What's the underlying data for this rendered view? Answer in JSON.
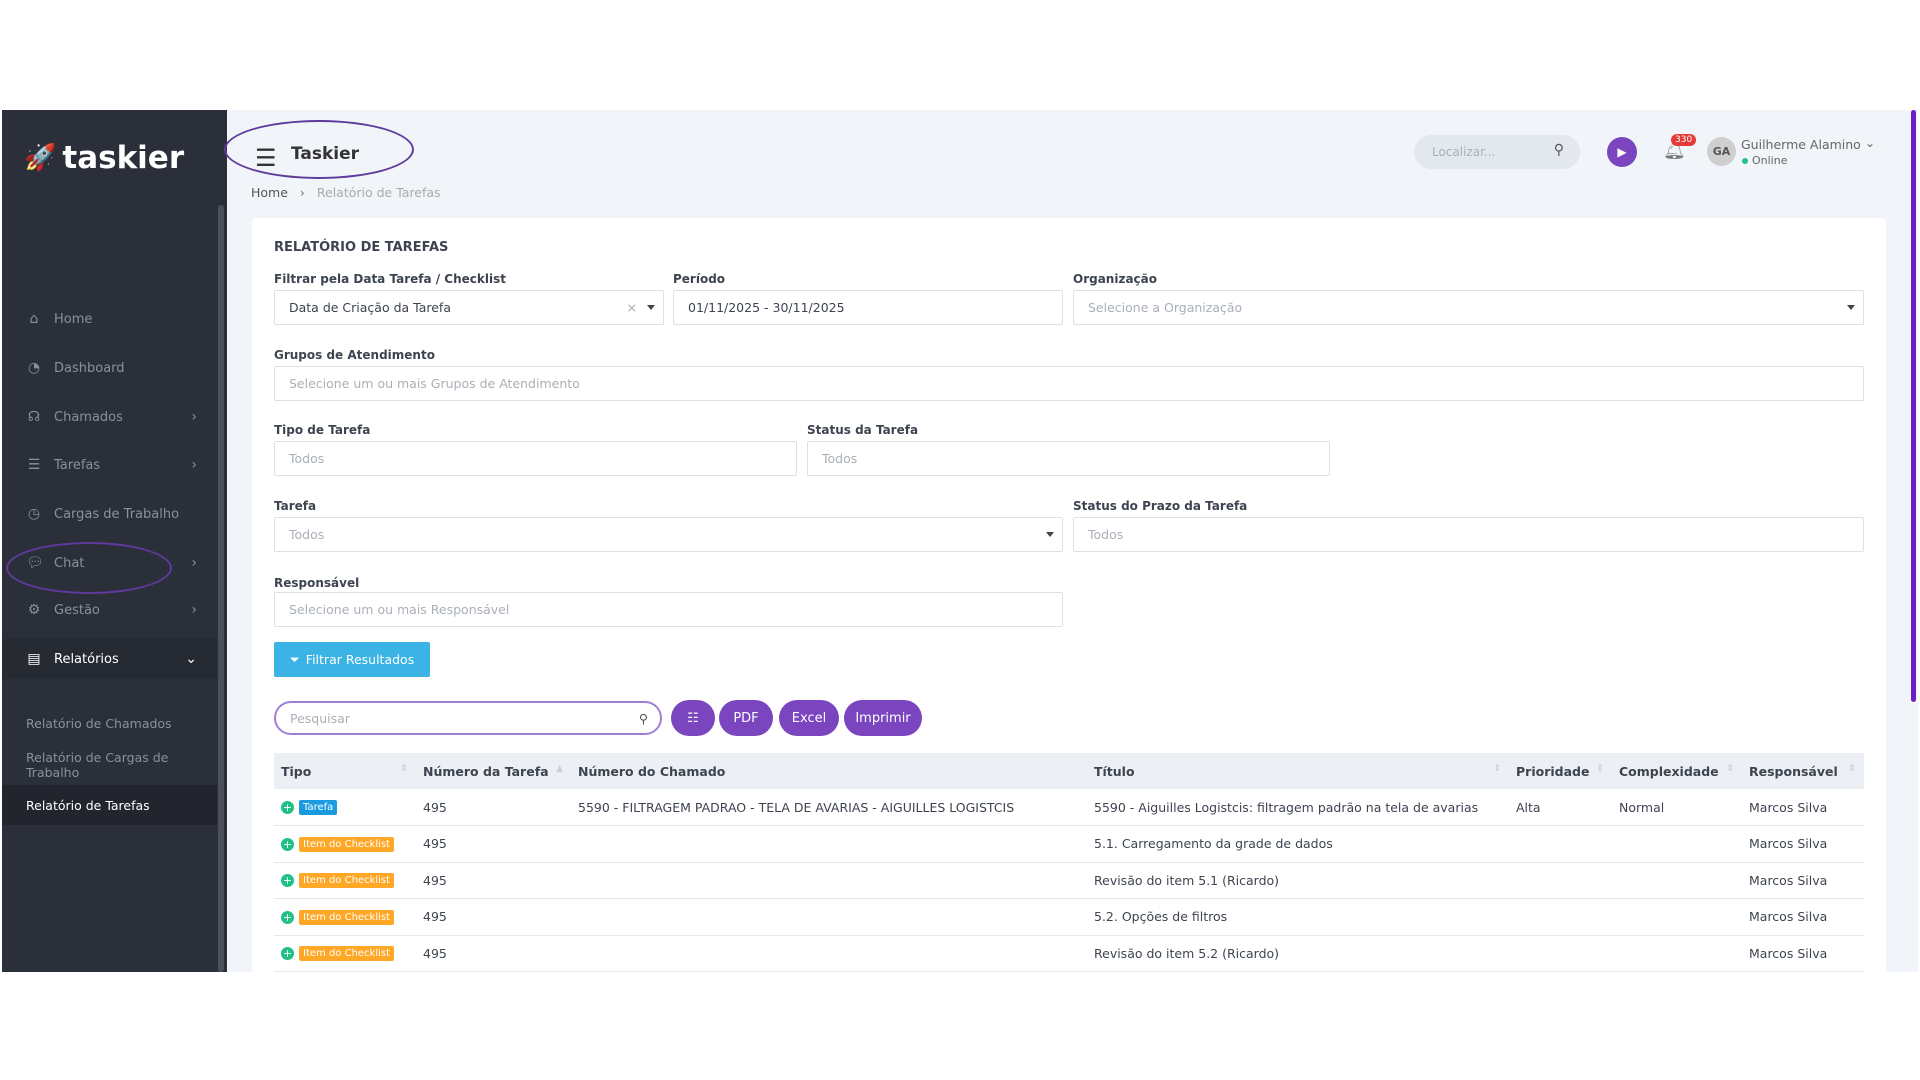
{
  "brand": {
    "name": "taskier"
  },
  "sidebar": {
    "items": [
      {
        "label": "Home",
        "icon": "home-icon"
      },
      {
        "label": "Dashboard",
        "icon": "pie-chart-icon"
      },
      {
        "label": "Chamados",
        "icon": "headset-icon"
      },
      {
        "label": "Tarefas",
        "icon": "list-icon"
      },
      {
        "label": "Cargas de Trabalho",
        "icon": "clock-icon"
      },
      {
        "label": "Chat",
        "icon": "chat-icon"
      },
      {
        "label": "Gestão",
        "icon": "gear-icon"
      },
      {
        "label": "Relatórios",
        "icon": "file-icon"
      }
    ],
    "subitems": [
      "Relatório de Chamados",
      "Relatório de Cargas de Trabalho",
      "Relatório de Tarefas"
    ]
  },
  "header": {
    "title": "Taskier",
    "search_placeholder": "Localizar...",
    "notif_count": "330",
    "user_initials": "GA",
    "user_name": "Guilherme Alamino",
    "user_status": "Online"
  },
  "breadcrumb": {
    "home": "Home",
    "current": "Relatório de Tarefas"
  },
  "form": {
    "title": "RELATÓRIO DE TAREFAS",
    "filtro_label": "Filtrar pela Data Tarefa / Checklist",
    "filtro_value": "Data de Criação da Tarefa",
    "periodo_label": "Período",
    "periodo_value": "01/11/2025 - 30/11/2025",
    "org_label": "Organização",
    "org_placeholder": "Selecione a Organização",
    "grupos_label": "Grupos de Atendimento",
    "grupos_placeholder": "Selecione um ou mais Grupos de Atendimento",
    "tipo_label": "Tipo de Tarefa",
    "tipo_placeholder": "Todos",
    "status_label": "Status da Tarefa",
    "status_placeholder": "Todos",
    "tarefa_label": "Tarefa",
    "tarefa_placeholder": "Todos",
    "prazo_label": "Status do Prazo da Tarefa",
    "prazo_placeholder": "Todos",
    "resp_label": "Responsável",
    "resp_placeholder": "Selecione um ou mais Responsável",
    "filter_button": "Filtrar Resultados"
  },
  "toolbar": {
    "search_placeholder": "Pesquisar",
    "pdf": "PDF",
    "excel": "Excel",
    "print": "Imprimir"
  },
  "table": {
    "columns": [
      "Tipo",
      "Número da Tarefa",
      "Número do Chamado",
      "Título",
      "Prioridade",
      "Complexidade",
      "Responsável"
    ],
    "rows": [
      {
        "tipo": "Tarefa",
        "tipo_color": "#1a9be0",
        "numero": "495",
        "chamado": "5590 - FILTRAGEM PADRAO - TELA DE AVARIAS - AIGUILLES LOGISTCIS",
        "titulo": "5590 - Aiguilles Logistcis: filtragem padrão na tela de avarias",
        "prioridade": "Alta",
        "complexidade": "Normal",
        "responsavel": "Marcos Silva"
      },
      {
        "tipo": "Item do Checklist",
        "tipo_color": "#ffa726",
        "numero": "495",
        "chamado": "",
        "titulo": "5.1. Carregamento da grade de dados",
        "prioridade": "",
        "complexidade": "",
        "responsavel": "Marcos Silva"
      },
      {
        "tipo": "Item do Checklist",
        "tipo_color": "#ffa726",
        "numero": "495",
        "chamado": "",
        "titulo": "Revisão do item 5.1 (Ricardo)",
        "prioridade": "",
        "complexidade": "",
        "responsavel": "Marcos Silva"
      },
      {
        "tipo": "Item do Checklist",
        "tipo_color": "#ffa726",
        "numero": "495",
        "chamado": "",
        "titulo": "5.2. Opções de filtros",
        "prioridade": "",
        "complexidade": "",
        "responsavel": "Marcos Silva"
      },
      {
        "tipo": "Item do Checklist",
        "tipo_color": "#ffa726",
        "numero": "495",
        "chamado": "",
        "titulo": "Revisão do item 5.2 (Ricardo)",
        "prioridade": "",
        "complexidade": "",
        "responsavel": "Marcos Silva"
      }
    ]
  }
}
